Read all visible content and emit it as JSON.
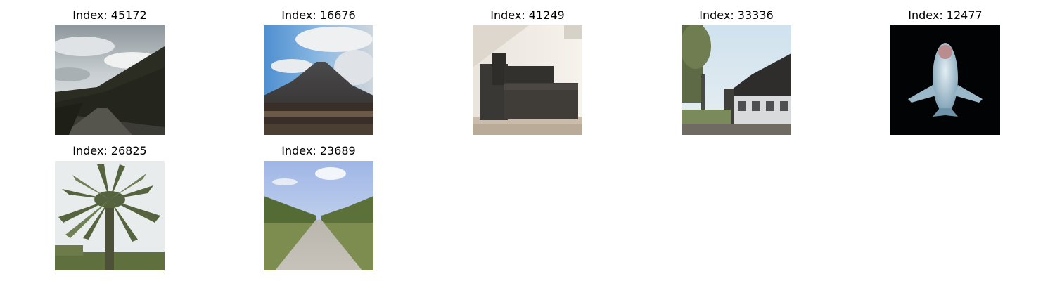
{
  "panels": [
    {
      "title": "Index: 45172",
      "subject": "road-valley-photo"
    },
    {
      "title": "Index: 16676",
      "subject": "mountain-photo"
    },
    {
      "title": "Index: 41249",
      "subject": "couch-photo"
    },
    {
      "title": "Index: 33336",
      "subject": "house-street-photo"
    },
    {
      "title": "Index: 12477",
      "subject": "airplane-photo"
    },
    {
      "title": "Index: 26825",
      "subject": "palm-tree-photo"
    },
    {
      "title": "Index: 23689",
      "subject": "country-road-photo"
    }
  ]
}
